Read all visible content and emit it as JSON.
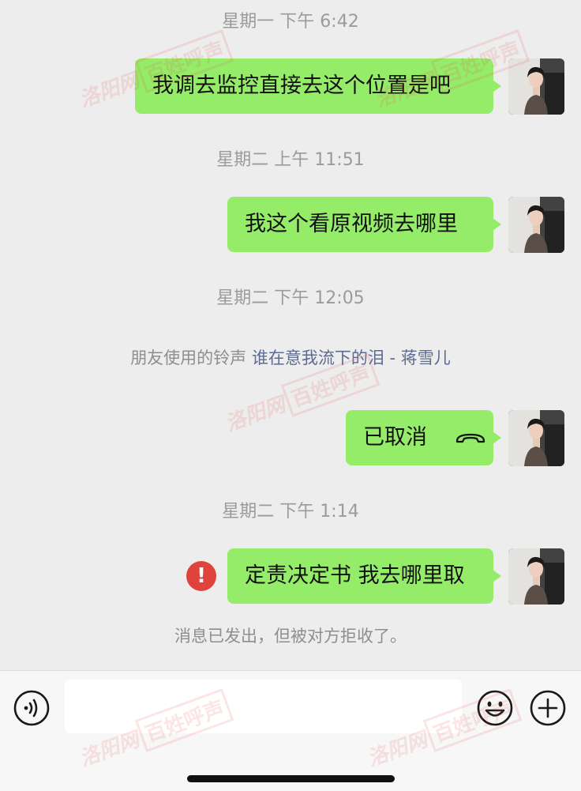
{
  "messages": [
    {
      "time": "星期一 下午 6:42",
      "text": "我调去监控直接去这个位置是吧"
    },
    {
      "time": "星期二 上午 11:51",
      "text": "我这个看原视频去哪里"
    },
    {
      "time": "星期二 下午 12:05",
      "text": "已取消"
    },
    {
      "time": "星期二 下午 1:14",
      "text": "定责决定书 我去哪里取"
    }
  ],
  "ringtone": {
    "prefix": "朋友使用的铃声",
    "song": "谁在意我流下的泪 - 蒋雪儿"
  },
  "call_icon": "phone-hangup-icon",
  "error_icon": {
    "symbol": "!",
    "name": "error-icon"
  },
  "rejected_notice": "消息已发出，但被对方拒收了。",
  "input": {
    "value": ""
  },
  "watermark": {
    "site": "洛阳网",
    "box": "百姓呼声"
  },
  "colors": {
    "bubble": "#95ec69",
    "background": "#ededed",
    "error": "#e0433b",
    "link": "#5b6b93"
  }
}
